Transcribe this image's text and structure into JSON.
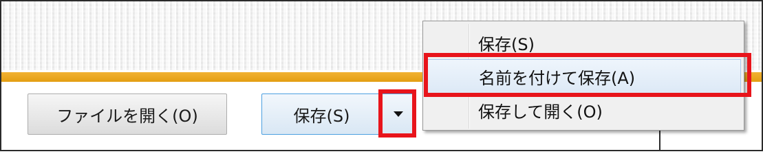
{
  "buttons": {
    "open_file": "ファイルを開く(O)",
    "save": "保存(S)"
  },
  "dropdown_menu": {
    "items": [
      {
        "label": "保存(S)"
      },
      {
        "label": "名前を付けて保存(A)"
      },
      {
        "label": "保存して開く(O)"
      }
    ],
    "highlighted_item": "名前を付けて保存(A)"
  },
  "colors": {
    "accent_bar": "#e8a21a",
    "annotation_highlight": "#e8141b",
    "primary_button_border": "#4b9fe0"
  },
  "icons": {
    "dropdown": "caret-down-icon"
  }
}
